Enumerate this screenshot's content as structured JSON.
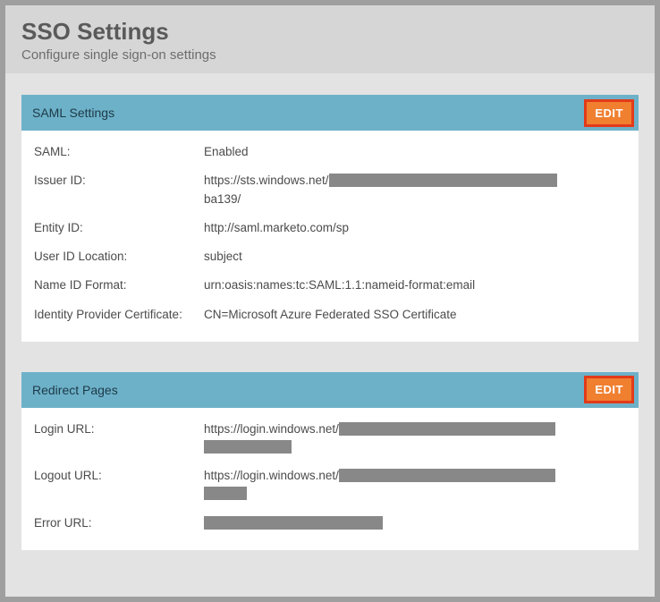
{
  "header": {
    "title": "SSO Settings",
    "subtitle": "Configure single sign-on settings"
  },
  "panels": {
    "saml": {
      "title": "SAML Settings",
      "edit_label": "EDIT",
      "fields": {
        "saml_label": "SAML:",
        "saml_value": "Enabled",
        "issuer_label": "Issuer ID:",
        "issuer_value_prefix": "https://sts.windows.net/",
        "issuer_value_suffix": "ba139/",
        "entity_label": "Entity ID:",
        "entity_value": "http://saml.marketo.com/sp",
        "userid_label": "User ID Location:",
        "userid_value": "subject",
        "nameid_label": "Name ID Format:",
        "nameid_value": "urn:oasis:names:tc:SAML:1.1:nameid-format:email",
        "idp_label": "Identity Provider Certificate:",
        "idp_value": "CN=Microsoft Azure Federated SSO Certificate"
      }
    },
    "redirect": {
      "title": "Redirect Pages",
      "edit_label": "EDIT",
      "fields": {
        "login_label": "Login URL:",
        "login_value_prefix": "https://login.windows.net/",
        "logout_label": "Logout URL:",
        "logout_value_prefix": "https://login.windows.net/",
        "error_label": "Error URL:"
      }
    }
  }
}
